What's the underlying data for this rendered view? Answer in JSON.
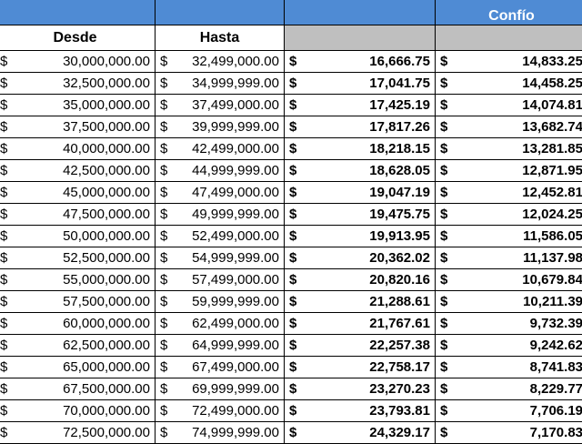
{
  "header": {
    "provider_label": "Confío",
    "col_from": "Desde",
    "col_to": "Hasta"
  },
  "currency": "$",
  "rows": [
    {
      "from": "30,000,000.00",
      "to": "32,499,000.00",
      "a": "16,666.75",
      "b": "14,833.25"
    },
    {
      "from": "32,500,000.00",
      "to": "34,999,999.00",
      "a": "17,041.75",
      "b": "14,458.25"
    },
    {
      "from": "35,000,000.00",
      "to": "37,499,000.00",
      "a": "17,425.19",
      "b": "14,074.81"
    },
    {
      "from": "37,500,000.00",
      "to": "39,999,999.00",
      "a": "17,817.26",
      "b": "13,682.74"
    },
    {
      "from": "40,000,000.00",
      "to": "42,499,000.00",
      "a": "18,218.15",
      "b": "13,281.85"
    },
    {
      "from": "42,500,000.00",
      "to": "44,999,999.00",
      "a": "18,628.05",
      "b": "12,871.95"
    },
    {
      "from": "45,000,000.00",
      "to": "47,499,000.00",
      "a": "19,047.19",
      "b": "12,452.81"
    },
    {
      "from": "47,500,000.00",
      "to": "49,999,999.00",
      "a": "19,475.75",
      "b": "12,024.25"
    },
    {
      "from": "50,000,000.00",
      "to": "52,499,000.00",
      "a": "19,913.95",
      "b": "11,586.05"
    },
    {
      "from": "52,500,000.00",
      "to": "54,999,999.00",
      "a": "20,362.02",
      "b": "11,137.98"
    },
    {
      "from": "55,000,000.00",
      "to": "57,499,000.00",
      "a": "20,820.16",
      "b": "10,679.84"
    },
    {
      "from": "57,500,000.00",
      "to": "59,999,999.00",
      "a": "21,288.61",
      "b": "10,211.39"
    },
    {
      "from": "60,000,000.00",
      "to": "62,499,000.00",
      "a": "21,767.61",
      "b": "9,732.39"
    },
    {
      "from": "62,500,000.00",
      "to": "64,999,999.00",
      "a": "22,257.38",
      "b": "9,242.62"
    },
    {
      "from": "65,000,000.00",
      "to": "67,499,000.00",
      "a": "22,758.17",
      "b": "8,741.83"
    },
    {
      "from": "67,500,000.00",
      "to": "69,999,999.00",
      "a": "23,270.23",
      "b": "8,229.77"
    },
    {
      "from": "70,000,000.00",
      "to": "72,499,000.00",
      "a": "23,793.81",
      "b": "7,706.19"
    },
    {
      "from": "72,500,000.00",
      "to": "74,999,999.00",
      "a": "24,329.17",
      "b": "7,170.83"
    }
  ]
}
